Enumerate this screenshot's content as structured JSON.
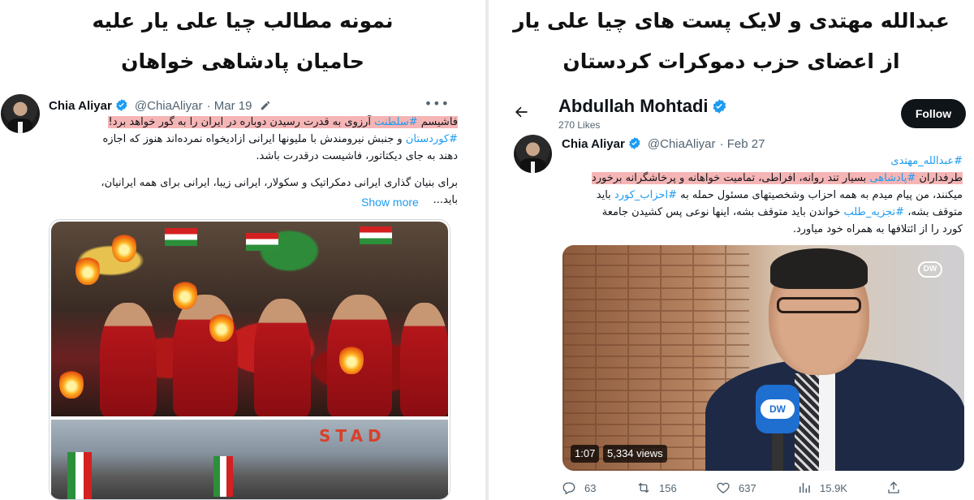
{
  "left_headline": {
    "line1": "نمونه مطالب چیا علی یار علیه",
    "line2": "حامیان پادشاهی خواهان"
  },
  "right_headline": {
    "line1": "عبدالله مهتدی و لایک پست های چیا علی یار",
    "line2": "از اعضای حزب دموکرات کردستان"
  },
  "left_tweet": {
    "author_name": "Chia Aliyar",
    "handle": "@ChiaAliyar",
    "date": "· Mar 19",
    "more_icon": "more-dots-icon",
    "line1_a": "فاشیسم ",
    "line1_tag": "#سلطنت",
    "line1_b": " آرزوی به قدرت رسیدن دوباره در ایران را به گور خواهد برد!",
    "line2_tag": "#کوردستان",
    "line2_b": " و جنبش نیرومندش با ملیونها ایرانی ازادیخواه نمرده‌اند هنوز که اجازه",
    "line3": "دهند به جای دیکتاتور، فاشیست درقدرت باشد.",
    "line4": "برای بنیان گذاری ایرانی دمکراتیک و سکولار، ایرانی زیبا، ایرانی برای همه ایرانیان،",
    "line5": "باید...",
    "show_more": "Show more",
    "stadium_sign": "STAD"
  },
  "right_panel": {
    "page_name": "Abdullah Mohtadi",
    "page_likes": "270 Likes",
    "follow_label": "Follow",
    "tweet": {
      "author_name": "Chia Aliyar",
      "handle": "@ChiaAliyar",
      "date": "· Feb 27",
      "tag_line": "#عبدالله_مهتدی",
      "hl_a": "طرفداران ",
      "hl_tag": "#پادشاهی",
      "hl_b": " بسیار تند روانه، افراطی، تمامیت خواهانه و پرخاشگرانه برخورد",
      "line3_a": "میکنند، من پیام میدم به همه احزاب وشخصیتهای مسئول حمله به ",
      "line3_tag": "#احزاب_کورد",
      "line3_b": " باید",
      "line4_a": "متوقف بشه، ",
      "line4_tag": "#تجزیه_طلب",
      "line4_b": " خواندن باید متوقف بشه، اینها نوعی پس کشیدن جامعة",
      "line5": "کورد را از ائتلافها به همراه خود میاورد."
    },
    "video": {
      "duration": "1:07",
      "views": "5,334 views",
      "mic_logo": "DW",
      "corner_badge": "DW"
    },
    "actions": {
      "replies": "63",
      "retweets": "156",
      "likes": "637",
      "views": "15.9K"
    }
  },
  "colors": {
    "accent": "#1d9bf0",
    "highlight": "#f5b5b5",
    "verified": "#1d9bf0",
    "follow_bg": "#0f1419"
  }
}
